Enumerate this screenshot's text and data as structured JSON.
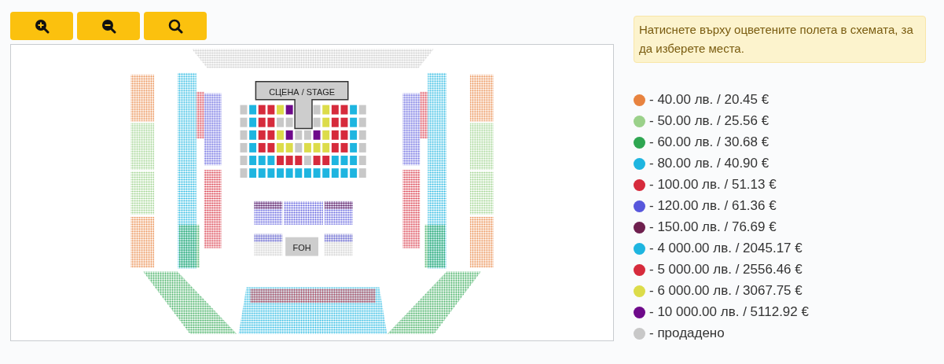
{
  "toolbar": {
    "buttons": [
      {
        "kind": "zoom-in"
      },
      {
        "kind": "zoom-out"
      },
      {
        "kind": "reset"
      }
    ]
  },
  "seat_map": {
    "stage_label": "СЦЕНА / STAGE",
    "foh_label": "FOH"
  },
  "hint": "Натиснете върху оцветените полета в схемата, за да изберете места.",
  "legend": [
    {
      "label": "- 40.00 лв. / 20.45 €",
      "color": "#e8833f"
    },
    {
      "label": "- 50.00 лв. / 25.56 €",
      "color": "#9bd18a"
    },
    {
      "label": "- 60.00 лв. / 30.68 €",
      "color": "#2ea651"
    },
    {
      "label": "- 80.00 лв. / 40.90 €",
      "color": "#1eb5e0"
    },
    {
      "label": "- 100.00 лв. / 51.13 €",
      "color": "#d62b3c"
    },
    {
      "label": "- 120.00 лв. / 61.36 €",
      "color": "#5757dc"
    },
    {
      "label": "- 150.00 лв. / 76.69 €",
      "color": "#6e1f4e"
    },
    {
      "label": "- 4 000.00 лв. / 2045.17 €",
      "color": "#1eb5e0"
    },
    {
      "label": "- 5 000.00 лв. / 2556.46 €",
      "color": "#d62b3c"
    },
    {
      "label": "- 6 000.00 лв. / 3067.75 €",
      "color": "#dcdc4a"
    },
    {
      "label": "- 10 000.00 лв. / 5112.92 €",
      "color": "#6e0a8a"
    },
    {
      "label": "- продадено",
      "color": "#c8c8c8"
    }
  ]
}
